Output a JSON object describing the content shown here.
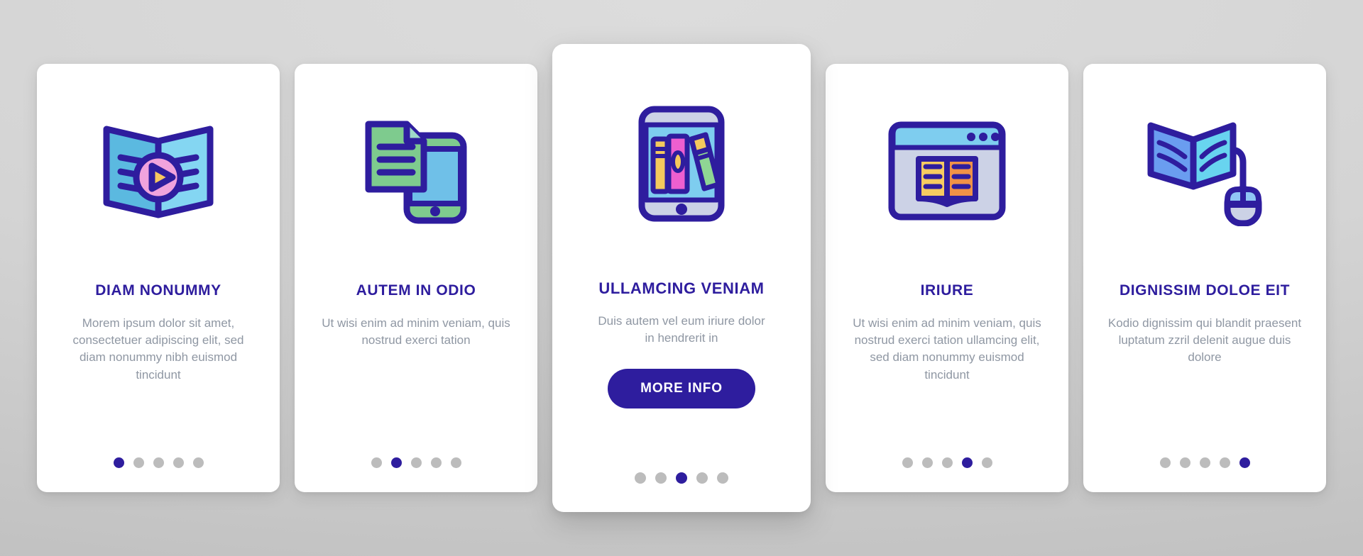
{
  "theme": {
    "accent": "#2e1d9e",
    "body_text": "#8f97a3",
    "card_bg": "#ffffff",
    "page_bg": "#d2d2d2",
    "dot_inactive": "#bcbcbc"
  },
  "cards": [
    {
      "icon": "open-book-audio-play-icon",
      "title": "DIAM NONUMMY",
      "body": "Morem ipsum dolor sit amet, consectetuer adipiscing elit, sed diam nonummy nibh euismod tincidunt",
      "dots": {
        "count": 5,
        "active": 0
      },
      "featured": false,
      "button": null
    },
    {
      "icon": "document-and-smartphone-icon",
      "title": "AUTEM IN ODIO",
      "body": "Ut wisi enim ad minim veniam, quis nostrud exerci tation",
      "dots": {
        "count": 5,
        "active": 1
      },
      "featured": false,
      "button": null
    },
    {
      "icon": "smartphone-bookshelf-icon",
      "title": "ULLAMCING VENIAM",
      "body": "Duis autem vel eum iriure dolor in hendrerit in",
      "dots": {
        "count": 5,
        "active": 2
      },
      "featured": true,
      "button": {
        "label": "MORE INFO"
      }
    },
    {
      "icon": "browser-window-open-book-icon",
      "title": "IRIURE",
      "body": "Ut wisi enim ad minim veniam, quis nostrud exerci tation ullamcing elit, sed diam nonummy euismod tincidunt",
      "dots": {
        "count": 5,
        "active": 3
      },
      "featured": false,
      "button": null
    },
    {
      "icon": "open-book-computer-mouse-icon",
      "title": "DIGNISSIM DOLOE EIT",
      "body": "Kodio dignissim qui blandit praesent luptatum zzril delenit augue duis dolore",
      "dots": {
        "count": 5,
        "active": 4
      },
      "featured": false,
      "button": null
    }
  ]
}
